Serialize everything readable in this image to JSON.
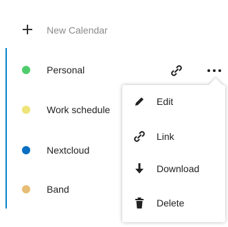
{
  "new_calendar": {
    "label": "New Calendar",
    "icon": "plus-icon"
  },
  "accent_color": "#0082c9",
  "calendars": [
    {
      "name": "Personal",
      "color": "#4fcc6b"
    },
    {
      "name": "Work schedule",
      "color": "#ede47a"
    },
    {
      "name": "Nextcloud",
      "color": "#0a6fc2"
    },
    {
      "name": "Band",
      "color": "#e7bd75"
    }
  ],
  "row_actions": {
    "link_icon": "link-icon",
    "more_icon": "more-icon"
  },
  "menu": {
    "items": [
      {
        "label": "Edit",
        "icon": "pencil-icon"
      },
      {
        "label": "Link",
        "icon": "link-icon"
      },
      {
        "label": "Download",
        "icon": "download-icon"
      },
      {
        "label": "Delete",
        "icon": "trash-icon"
      }
    ]
  }
}
